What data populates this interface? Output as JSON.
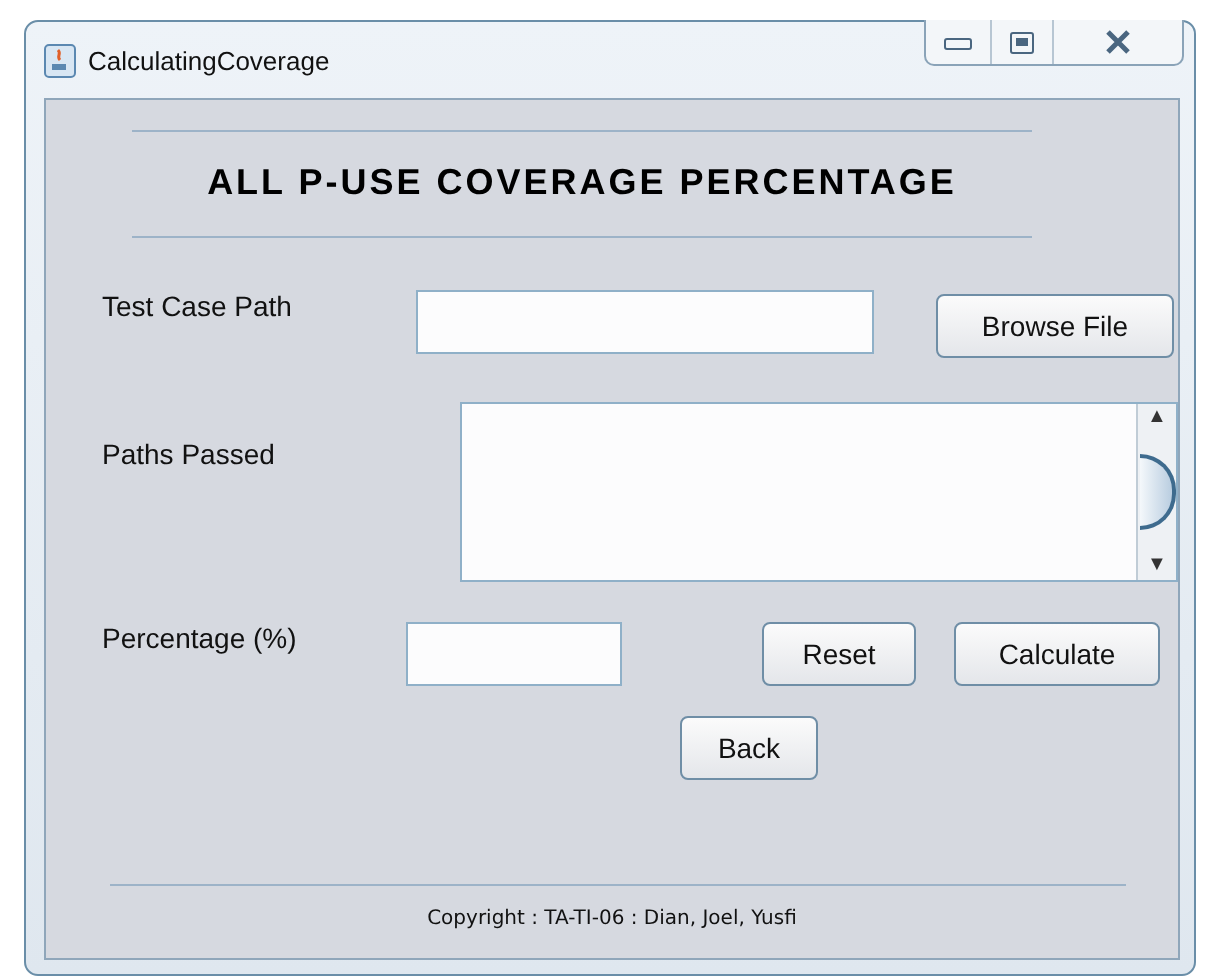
{
  "window": {
    "title": "CalculatingCoverage"
  },
  "heading": "ALL P-USE COVERAGE PERCENTAGE",
  "test_case_path": {
    "label": "Test Case Path",
    "button": "Browse File"
  },
  "paths_passed": {
    "label": "Paths Passed",
    "scroll_up": "▲",
    "scroll_down": "▼"
  },
  "percentage": {
    "label": "Percentage (%)"
  },
  "buttons": [
    "Reset",
    "Calculate",
    "Back"
  ],
  "footer": "Copyright : TA-TI-06 : Dian, Joel, Yusfi"
}
